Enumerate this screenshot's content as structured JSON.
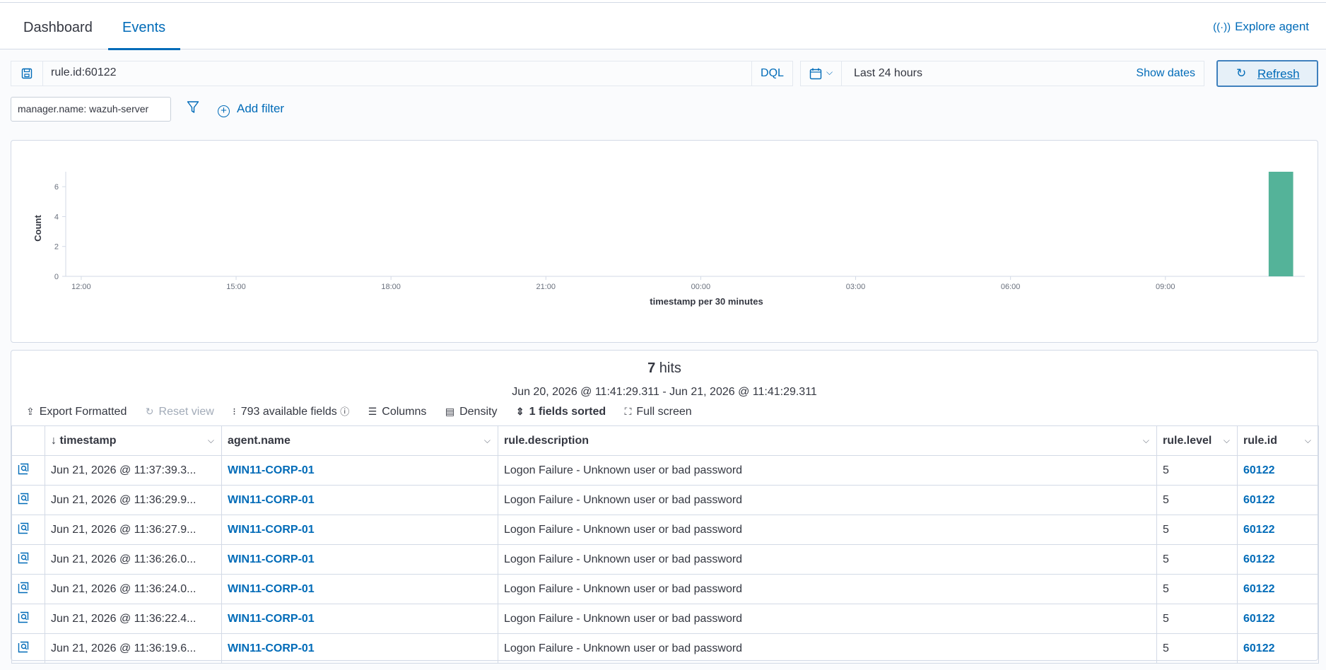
{
  "tabs": [
    {
      "label": "Dashboard",
      "active": false
    },
    {
      "label": "Events",
      "active": true
    }
  ],
  "explore_agent": {
    "label": "Explore agent",
    "icon": "antenna-icon"
  },
  "query": {
    "value": "rule.id:60122",
    "language": "DQL"
  },
  "date": {
    "range": "Last 24 hours",
    "show_dates": "Show dates"
  },
  "refresh_label": "Refresh",
  "filters": [
    {
      "label": "manager.name: wazuh-server"
    }
  ],
  "add_filter_label": "Add filter",
  "chart_data": {
    "type": "bar",
    "xlabel": "timestamp per 30 minutes",
    "ylabel": "Count",
    "ylim": [
      0,
      7
    ],
    "yticks": [
      0,
      2,
      4,
      6
    ],
    "xticks": [
      "12:00",
      "15:00",
      "18:00",
      "21:00",
      "00:00",
      "03:00",
      "06:00",
      "09:00"
    ],
    "x_range_hours": [
      11.7,
      35.7
    ],
    "bars": [
      {
        "x_hour": 35.0,
        "value": 7
      }
    ],
    "bar_color": "#54b399",
    "grid": false
  },
  "results": {
    "hits_count": "7",
    "hits_label": "hits",
    "date_range": "Jun 20, 2026 @ 11:41:29.311 - Jun 21, 2026 @ 11:41:29.311"
  },
  "toolbar": {
    "export": "Export Formatted",
    "reset": "Reset view",
    "fields": "793 available fields",
    "columns": "Columns",
    "density": "Density",
    "sorted": "1 fields sorted",
    "fullscreen": "Full screen"
  },
  "columns": [
    "timestamp",
    "agent.name",
    "rule.description",
    "rule.level",
    "rule.id"
  ],
  "rows": [
    {
      "timestamp": "Jun 21, 2026 @ 11:37:39.3...",
      "agent": "WIN11-CORP-01",
      "description": "Logon Failure - Unknown user or bad password",
      "level": "5",
      "rule_id": "60122"
    },
    {
      "timestamp": "Jun 21, 2026 @ 11:36:29.9...",
      "agent": "WIN11-CORP-01",
      "description": "Logon Failure - Unknown user or bad password",
      "level": "5",
      "rule_id": "60122"
    },
    {
      "timestamp": "Jun 21, 2026 @ 11:36:27.9...",
      "agent": "WIN11-CORP-01",
      "description": "Logon Failure - Unknown user or bad password",
      "level": "5",
      "rule_id": "60122"
    },
    {
      "timestamp": "Jun 21, 2026 @ 11:36:26.0...",
      "agent": "WIN11-CORP-01",
      "description": "Logon Failure - Unknown user or bad password",
      "level": "5",
      "rule_id": "60122"
    },
    {
      "timestamp": "Jun 21, 2026 @ 11:36:24.0...",
      "agent": "WIN11-CORP-01",
      "description": "Logon Failure - Unknown user or bad password",
      "level": "5",
      "rule_id": "60122"
    },
    {
      "timestamp": "Jun 21, 2026 @ 11:36:22.4...",
      "agent": "WIN11-CORP-01",
      "description": "Logon Failure - Unknown user or bad password",
      "level": "5",
      "rule_id": "60122"
    },
    {
      "timestamp": "Jun 21, 2026 @ 11:36:19.6...",
      "agent": "WIN11-CORP-01",
      "description": "Logon Failure - Unknown user or bad password",
      "level": "5",
      "rule_id": "60122"
    }
  ]
}
